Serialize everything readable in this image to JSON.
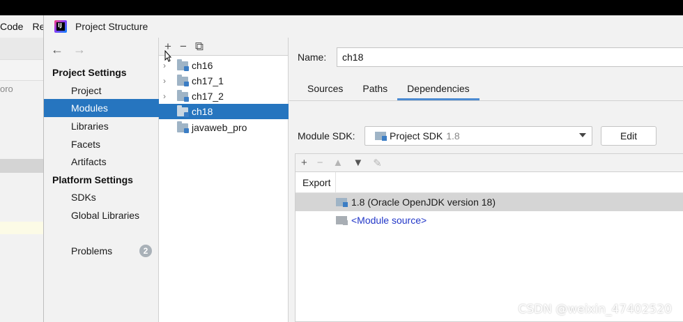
{
  "background_ide": {
    "menu": [
      "Code",
      "Re"
    ],
    "project_fragment": "oro"
  },
  "dialog": {
    "title": "Project Structure",
    "nav": {
      "back_icon": "arrow-left-icon",
      "forward_icon": "arrow-right-icon",
      "project_settings_header": "Project Settings",
      "project_settings_items": [
        "Project",
        "Modules",
        "Libraries",
        "Facets",
        "Artifacts"
      ],
      "platform_settings_header": "Platform Settings",
      "platform_settings_items": [
        "SDKs",
        "Global Libraries"
      ],
      "problems_label": "Problems",
      "problems_count": "2",
      "selected": "Modules"
    },
    "tree": {
      "tools": {
        "add": "+",
        "remove": "−",
        "copy": "⧉"
      },
      "modules": [
        {
          "name": "ch16",
          "expandable": true
        },
        {
          "name": "ch17_1",
          "expandable": true
        },
        {
          "name": "ch17_2",
          "expandable": true
        },
        {
          "name": "ch18",
          "expandable": false
        },
        {
          "name": "javaweb_pro",
          "expandable": false
        }
      ],
      "selected": "ch18"
    },
    "content": {
      "name_label": "Name:",
      "name_value": "ch18",
      "tabs": [
        "Sources",
        "Paths",
        "Dependencies"
      ],
      "active_tab": "Dependencies",
      "sdk_label": "Module SDK:",
      "sdk_value": "Project SDK",
      "sdk_version": "1.8",
      "edit_label": "Edit",
      "dep_tools": {
        "add": "+",
        "remove": "−",
        "up": "▲",
        "down": "▼",
        "edit": "✎"
      },
      "export_header": "Export",
      "dependencies": [
        {
          "label": "1.8 (Oracle OpenJDK version 18)",
          "selected": true
        },
        {
          "label": "<Module source>",
          "selected": false
        }
      ]
    }
  },
  "watermark": "CSDN @weixin_47402520",
  "colors": {
    "selection": "#2675bf",
    "tab_underline": "#4b8ad1",
    "link": "#2237c8",
    "badge": "#a9b1b8"
  }
}
